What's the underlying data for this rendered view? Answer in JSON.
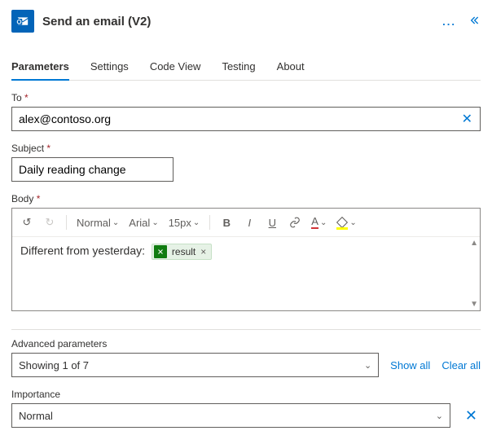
{
  "header": {
    "title": "Send an email (V2)",
    "menu_label": "...",
    "collapse_label": "collapse"
  },
  "tabs": [
    {
      "label": "Parameters",
      "active": true
    },
    {
      "label": "Settings",
      "active": false
    },
    {
      "label": "Code View",
      "active": false
    },
    {
      "label": "Testing",
      "active": false
    },
    {
      "label": "About",
      "active": false
    }
  ],
  "fields": {
    "to": {
      "label": "To",
      "required": true,
      "value": "alex@contoso.org"
    },
    "subject": {
      "label": "Subject",
      "required": true,
      "value": "Daily reading change"
    },
    "body": {
      "label": "Body",
      "required": true,
      "text": "Different from yesterday: ",
      "token": {
        "source": "excel",
        "label": "result"
      }
    }
  },
  "toolbar": {
    "style_label": "Normal",
    "font_label": "Arial",
    "size_label": "15px"
  },
  "advanced": {
    "section_label": "Advanced parameters",
    "summary": "Showing 1 of 7",
    "show_all": "Show all",
    "clear_all": "Clear all"
  },
  "importance": {
    "label": "Importance",
    "value": "Normal"
  }
}
